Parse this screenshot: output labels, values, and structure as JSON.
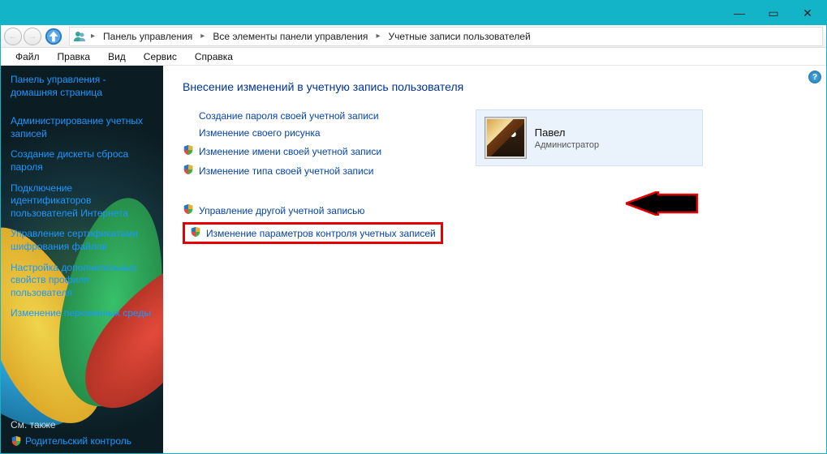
{
  "window": {
    "minimize": "—",
    "maximize": "▭",
    "close": "✕"
  },
  "nav": {
    "back": "←",
    "forward": "→"
  },
  "breadcrumb": {
    "items": [
      "Панель управления",
      "Все элементы панели управления",
      "Учетные записи пользователей"
    ]
  },
  "menu": {
    "file": "Файл",
    "edit": "Правка",
    "view": "Вид",
    "service": "Сервис",
    "help": "Справка"
  },
  "sidebar": {
    "links": [
      "Панель управления - домашняя страница",
      "Администрирование учетных записей",
      "Создание дискеты сброса пароля",
      "Подключение идентификаторов пользователей Интернета",
      "Управление сертификатами шифрования файлов",
      "Настройка дополнительных свойств профиля пользователя",
      "Изменение переменных среды"
    ],
    "see_also": "См. также",
    "parental": "Родительский контроль"
  },
  "content": {
    "title": "Внесение изменений в учетную запись пользователя",
    "tasks_primary": [
      "Создание пароля своей учетной записи",
      "Изменение своего рисунка"
    ],
    "tasks_shield": [
      "Изменение имени своей учетной записи",
      "Изменение типа своей учетной записи"
    ],
    "tasks_secondary": [
      "Управление другой учетной записью"
    ],
    "task_highlighted": "Изменение параметров контроля учетных записей",
    "help": "?"
  },
  "account": {
    "name": "Павел",
    "role": "Администратор"
  }
}
